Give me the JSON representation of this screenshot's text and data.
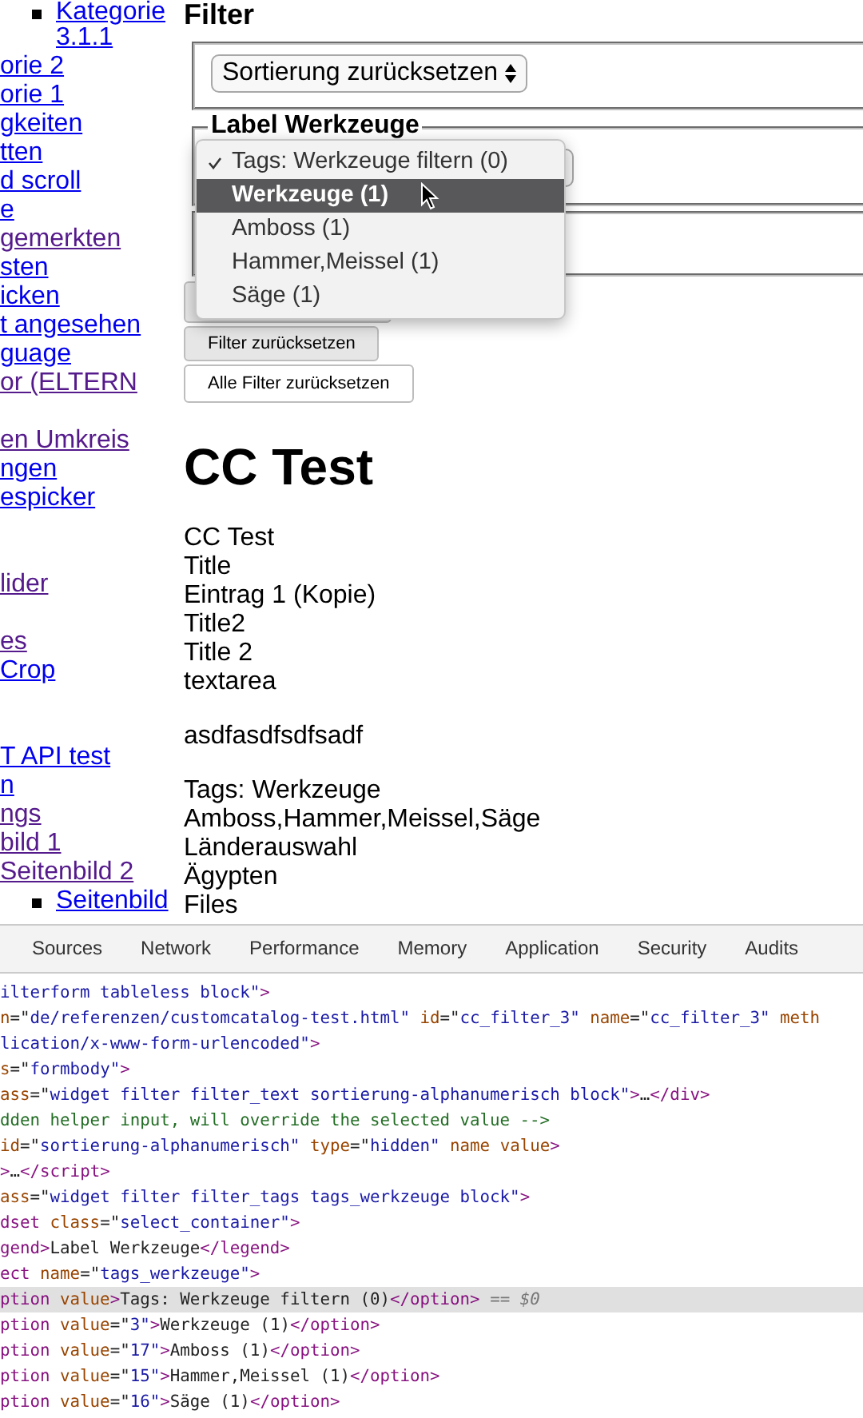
{
  "sidebar": {
    "links": [
      {
        "text": "Kategorie 3.1.1",
        "kind": "bullet",
        "visited": false
      },
      {
        "text": "orie 2",
        "kind": "plain",
        "visited": false
      },
      {
        "text": "orie 1",
        "kind": "plain",
        "visited": false
      },
      {
        "text": "gkeiten",
        "kind": "plain",
        "visited": false
      },
      {
        "text": "tten",
        "kind": "plain",
        "visited": false
      },
      {
        "text": "d scroll",
        "kind": "plain",
        "visited": false
      },
      {
        "text": "e",
        "kind": "plain",
        "visited": false
      },
      {
        "text": "gemerkten",
        "kind": "plain",
        "visited": true
      },
      {
        "text": "sten",
        "kind": "plain",
        "visited": false
      },
      {
        "text": "icken",
        "kind": "plain",
        "visited": false
      },
      {
        "text": "t angesehen",
        "kind": "plain",
        "visited": false
      },
      {
        "text": "guage",
        "kind": "plain",
        "visited": false
      },
      {
        "text": "or (ELTERN",
        "kind": "plain",
        "visited": true
      },
      {
        "text": "en Umkreis",
        "kind": "spaced",
        "visited": true
      },
      {
        "text": "ngen",
        "kind": "plain",
        "visited": false
      },
      {
        "text": "espicker",
        "kind": "plain",
        "visited": false
      },
      {
        "text": "lider",
        "kind": "spaced2",
        "visited": true
      },
      {
        "text": "es",
        "kind": "spaced",
        "visited": true
      },
      {
        "text": "Crop",
        "kind": "plain",
        "visited": false
      },
      {
        "text": "T API test",
        "kind": "spaced2",
        "visited": false
      },
      {
        "text": "n",
        "kind": "plain",
        "visited": false
      },
      {
        "text": "ngs",
        "kind": "plain",
        "visited": true
      },
      {
        "text": "bild 1",
        "kind": "plain",
        "visited": true
      },
      {
        "text": "Seitenbild 2",
        "kind": "plain",
        "visited": true
      },
      {
        "text": "Seitenbild",
        "kind": "bullet",
        "visited": false
      }
    ]
  },
  "filter": {
    "heading": "Filter",
    "sort_select": "Sortierung zurücksetzen",
    "legend": "Label Werkzeuge",
    "dropdown": [
      {
        "text": "Tags: Werkzeuge filtern (0)",
        "selected": true,
        "highlighted": false
      },
      {
        "text": "Werkzeuge (1)",
        "selected": false,
        "highlighted": true
      },
      {
        "text": "Amboss (1)",
        "selected": false,
        "highlighted": false
      },
      {
        "text": "Hammer,Meissel (1)",
        "selected": false,
        "highlighted": false
      },
      {
        "text": "Säge (1)",
        "selected": false,
        "highlighted": false
      }
    ],
    "buttons": [
      "Filter zurücksetzen",
      "Alle Filter zurücksetzen"
    ]
  },
  "content": {
    "title": "CC Test",
    "blocks": [
      [
        "CC Test",
        "Title",
        "Eintrag 1 (Kopie)",
        "Title2",
        "Title 2",
        "textarea"
      ],
      [
        "asdfasdfsdfsadf"
      ],
      [
        "Tags: Werkzeuge",
        "Amboss,Hammer,Meissel,Säge",
        "Länderauswahl",
        "Ägypten",
        "Files"
      ]
    ]
  },
  "devtools": {
    "tabs": [
      {
        "label": "Sources",
        "selected": false
      },
      {
        "label": "Network",
        "selected": false
      },
      {
        "label": "Performance",
        "selected": false
      },
      {
        "label": "Memory",
        "selected": false
      },
      {
        "label": "Application",
        "selected": false
      },
      {
        "label": "Security",
        "selected": false
      },
      {
        "label": "Audits",
        "selected": false
      }
    ],
    "code": [
      {
        "selected": false,
        "parts": [
          {
            "kind": "value",
            "text": "ilterform tableless block\""
          },
          {
            "kind": "tag",
            "text": ">"
          }
        ]
      },
      {
        "selected": false,
        "parts": [
          {
            "kind": "attr",
            "text": "n"
          },
          {
            "kind": "text",
            "text": "=\""
          },
          {
            "kind": "value",
            "text": "de/referenzen/customcatalog-test.html\""
          },
          {
            "kind": "attr",
            "text": " id"
          },
          {
            "kind": "text",
            "text": "=\""
          },
          {
            "kind": "value",
            "text": "cc_filter_3\""
          },
          {
            "kind": "attr",
            "text": " name"
          },
          {
            "kind": "text",
            "text": "=\""
          },
          {
            "kind": "value",
            "text": "cc_filter_3\""
          },
          {
            "kind": "attr",
            "text": " meth"
          }
        ]
      },
      {
        "selected": false,
        "parts": [
          {
            "kind": "value",
            "text": "lication/x-www-form-urlencoded\""
          },
          {
            "kind": "tag",
            "text": ">"
          }
        ]
      },
      {
        "selected": false,
        "parts": [
          {
            "kind": "attr",
            "text": "s"
          },
          {
            "kind": "text",
            "text": "=\""
          },
          {
            "kind": "value",
            "text": "formbody\""
          },
          {
            "kind": "tag",
            "text": ">"
          }
        ]
      },
      {
        "selected": false,
        "parts": [
          {
            "kind": "attr",
            "text": "ass"
          },
          {
            "kind": "text",
            "text": "=\""
          },
          {
            "kind": "value",
            "text": "widget filter filter_text sortierung-alphanumerisch block\""
          },
          {
            "kind": "tag",
            "text": ">"
          },
          {
            "kind": "text",
            "text": "…"
          },
          {
            "kind": "tag",
            "text": "</div>"
          }
        ]
      },
      {
        "selected": false,
        "parts": [
          {
            "kind": "comment",
            "text": "dden helper input, will override the selected value -->"
          }
        ]
      },
      {
        "selected": false,
        "parts": [
          {
            "kind": "attr",
            "text": "id"
          },
          {
            "kind": "text",
            "text": "=\""
          },
          {
            "kind": "value",
            "text": "sortierung-alphanumerisch\""
          },
          {
            "kind": "attr",
            "text": " type"
          },
          {
            "kind": "text",
            "text": "=\""
          },
          {
            "kind": "value",
            "text": "hidden\""
          },
          {
            "kind": "attr",
            "text": " name value"
          },
          {
            "kind": "tag",
            "text": ">"
          }
        ]
      },
      {
        "selected": false,
        "parts": [
          {
            "kind": "tag",
            "text": ">"
          },
          {
            "kind": "text",
            "text": "…"
          },
          {
            "kind": "tag",
            "text": "</script>"
          }
        ]
      },
      {
        "selected": false,
        "parts": [
          {
            "kind": "attr",
            "text": "ass"
          },
          {
            "kind": "text",
            "text": "=\""
          },
          {
            "kind": "value",
            "text": "widget filter filter_tags tags_werkzeuge block\""
          },
          {
            "kind": "tag",
            "text": ">"
          }
        ]
      },
      {
        "selected": false,
        "parts": [
          {
            "kind": "tag",
            "text": "dset"
          },
          {
            "kind": "attr",
            "text": " class"
          },
          {
            "kind": "text",
            "text": "=\""
          },
          {
            "kind": "value",
            "text": "select_container\""
          },
          {
            "kind": "tag",
            "text": ">"
          }
        ]
      },
      {
        "selected": false,
        "parts": [
          {
            "kind": "tag",
            "text": "gend>"
          },
          {
            "kind": "text",
            "text": "Label Werkzeuge"
          },
          {
            "kind": "tag",
            "text": "</legend>"
          }
        ]
      },
      {
        "selected": false,
        "parts": [
          {
            "kind": "tag",
            "text": "ect"
          },
          {
            "kind": "attr",
            "text": " name"
          },
          {
            "kind": "text",
            "text": "=\""
          },
          {
            "kind": "value",
            "text": "tags_werkzeuge\""
          },
          {
            "kind": "tag",
            "text": ">"
          }
        ]
      },
      {
        "selected": true,
        "parts": [
          {
            "kind": "tag",
            "text": "ption"
          },
          {
            "kind": "attr",
            "text": " value"
          },
          {
            "kind": "tag",
            "text": ">"
          },
          {
            "kind": "text",
            "text": "Tags: Werkzeuge filtern (0)"
          },
          {
            "kind": "tag",
            "text": "</option>"
          },
          {
            "kind": "marker",
            "text": " == $0"
          }
        ]
      },
      {
        "selected": false,
        "parts": [
          {
            "kind": "tag",
            "text": "ption"
          },
          {
            "kind": "attr",
            "text": " value"
          },
          {
            "kind": "text",
            "text": "=\""
          },
          {
            "kind": "value",
            "text": "3\""
          },
          {
            "kind": "tag",
            "text": ">"
          },
          {
            "kind": "text",
            "text": "Werkzeuge (1)"
          },
          {
            "kind": "tag",
            "text": "</option>"
          }
        ]
      },
      {
        "selected": false,
        "parts": [
          {
            "kind": "tag",
            "text": "ption"
          },
          {
            "kind": "attr",
            "text": " value"
          },
          {
            "kind": "text",
            "text": "=\""
          },
          {
            "kind": "value",
            "text": "17\""
          },
          {
            "kind": "tag",
            "text": ">"
          },
          {
            "kind": "text",
            "text": "Amboss (1)"
          },
          {
            "kind": "tag",
            "text": "</option>"
          }
        ]
      },
      {
        "selected": false,
        "parts": [
          {
            "kind": "tag",
            "text": "ption"
          },
          {
            "kind": "attr",
            "text": " value"
          },
          {
            "kind": "text",
            "text": "=\""
          },
          {
            "kind": "value",
            "text": "15\""
          },
          {
            "kind": "tag",
            "text": ">"
          },
          {
            "kind": "text",
            "text": "Hammer,Meissel (1)"
          },
          {
            "kind": "tag",
            "text": "</option>"
          }
        ]
      },
      {
        "selected": false,
        "parts": [
          {
            "kind": "tag",
            "text": "ption"
          },
          {
            "kind": "attr",
            "text": " value"
          },
          {
            "kind": "text",
            "text": "=\""
          },
          {
            "kind": "value",
            "text": "16\""
          },
          {
            "kind": "tag",
            "text": ">"
          },
          {
            "kind": "text",
            "text": "Säge (1)"
          },
          {
            "kind": "tag",
            "text": "</option>"
          }
        ]
      }
    ]
  }
}
